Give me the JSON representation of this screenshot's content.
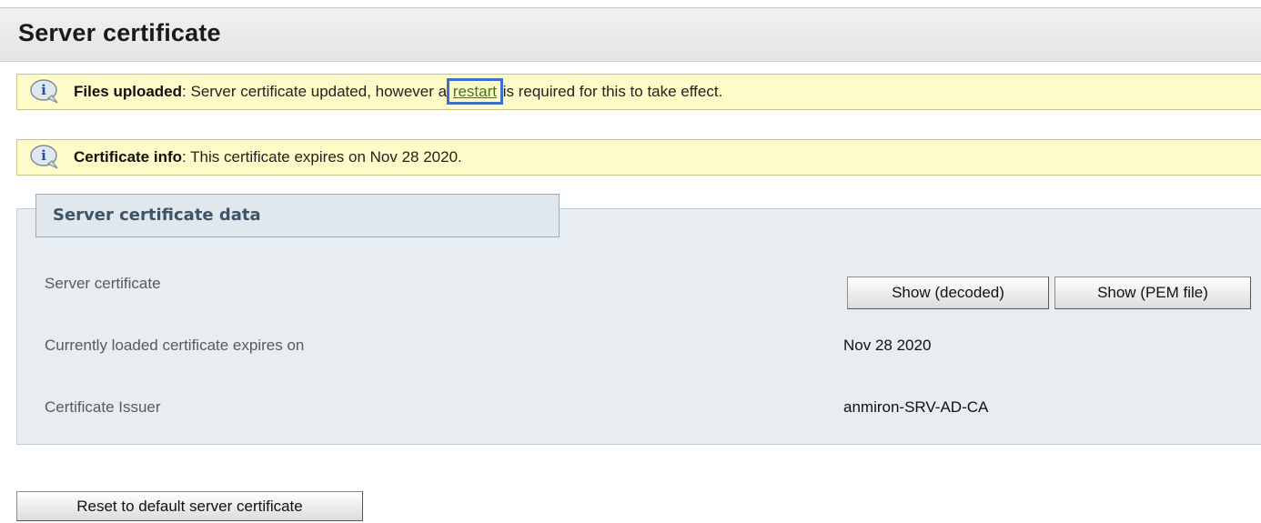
{
  "header": {
    "title": "Server certificate"
  },
  "notices": [
    {
      "icon": "info-icon",
      "bold": "Files uploaded",
      "text_before": ": Server certificate updated, however a ",
      "link": "restart",
      "text_after": " is required for this to take effect."
    },
    {
      "icon": "info-icon",
      "bold": "Certificate info",
      "text": ": This certificate expires on Nov 28 2020."
    }
  ],
  "panel": {
    "legend": "Server certificate data",
    "rows": [
      {
        "label": "Server certificate"
      },
      {
        "label": "Currently loaded certificate expires on",
        "value": "Nov 28 2020"
      },
      {
        "label": "Certificate Issuer",
        "value": "anmiron-SRV-AD-CA"
      }
    ],
    "buttons": {
      "show_decoded": "Show (decoded)",
      "show_pem": "Show (PEM file)"
    }
  },
  "footer": {
    "reset_button": "Reset to default server certificate"
  },
  "colors": {
    "notice_bg": "#fefbc8",
    "panel_bg": "#e8edf1",
    "legend_text": "#3d5366",
    "link": "#3c7a14",
    "highlight": "#3f6fc4"
  }
}
